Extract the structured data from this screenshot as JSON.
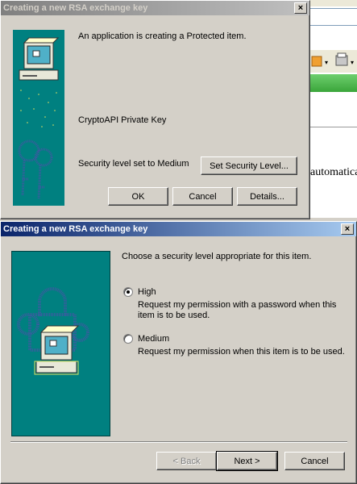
{
  "background_window": {
    "partial_text": "automatica"
  },
  "dialog1": {
    "title": "Creating a new RSA exchange key",
    "message": "An application is creating a Protected item.",
    "item_name": "CryptoAPI Private Key",
    "security_level_text": "Security level set to Medium",
    "set_security_button": "Set Security Level...",
    "ok_button": "OK",
    "cancel_button": "Cancel",
    "details_button": "Details...",
    "close_glyph": "×"
  },
  "dialog2": {
    "title": "Creating a new RSA exchange key",
    "instruction": "Choose a security level appropriate for this item.",
    "options": [
      {
        "label": "High",
        "desc_line1": "Request my permission with a password when this",
        "desc_line2": "item is to be used.",
        "selected": true
      },
      {
        "label": "Medium",
        "desc_line1": "Request my permission when this item is to be used.",
        "desc_line2": "",
        "selected": false
      }
    ],
    "back_button": "< Back",
    "next_button": "Next >",
    "cancel_button": "Cancel",
    "close_glyph": "×"
  },
  "colors": {
    "panel": "#008080",
    "dialog_face": "#d4d0c8",
    "active_title": "#0a246a",
    "inactive_title": "#808080"
  }
}
